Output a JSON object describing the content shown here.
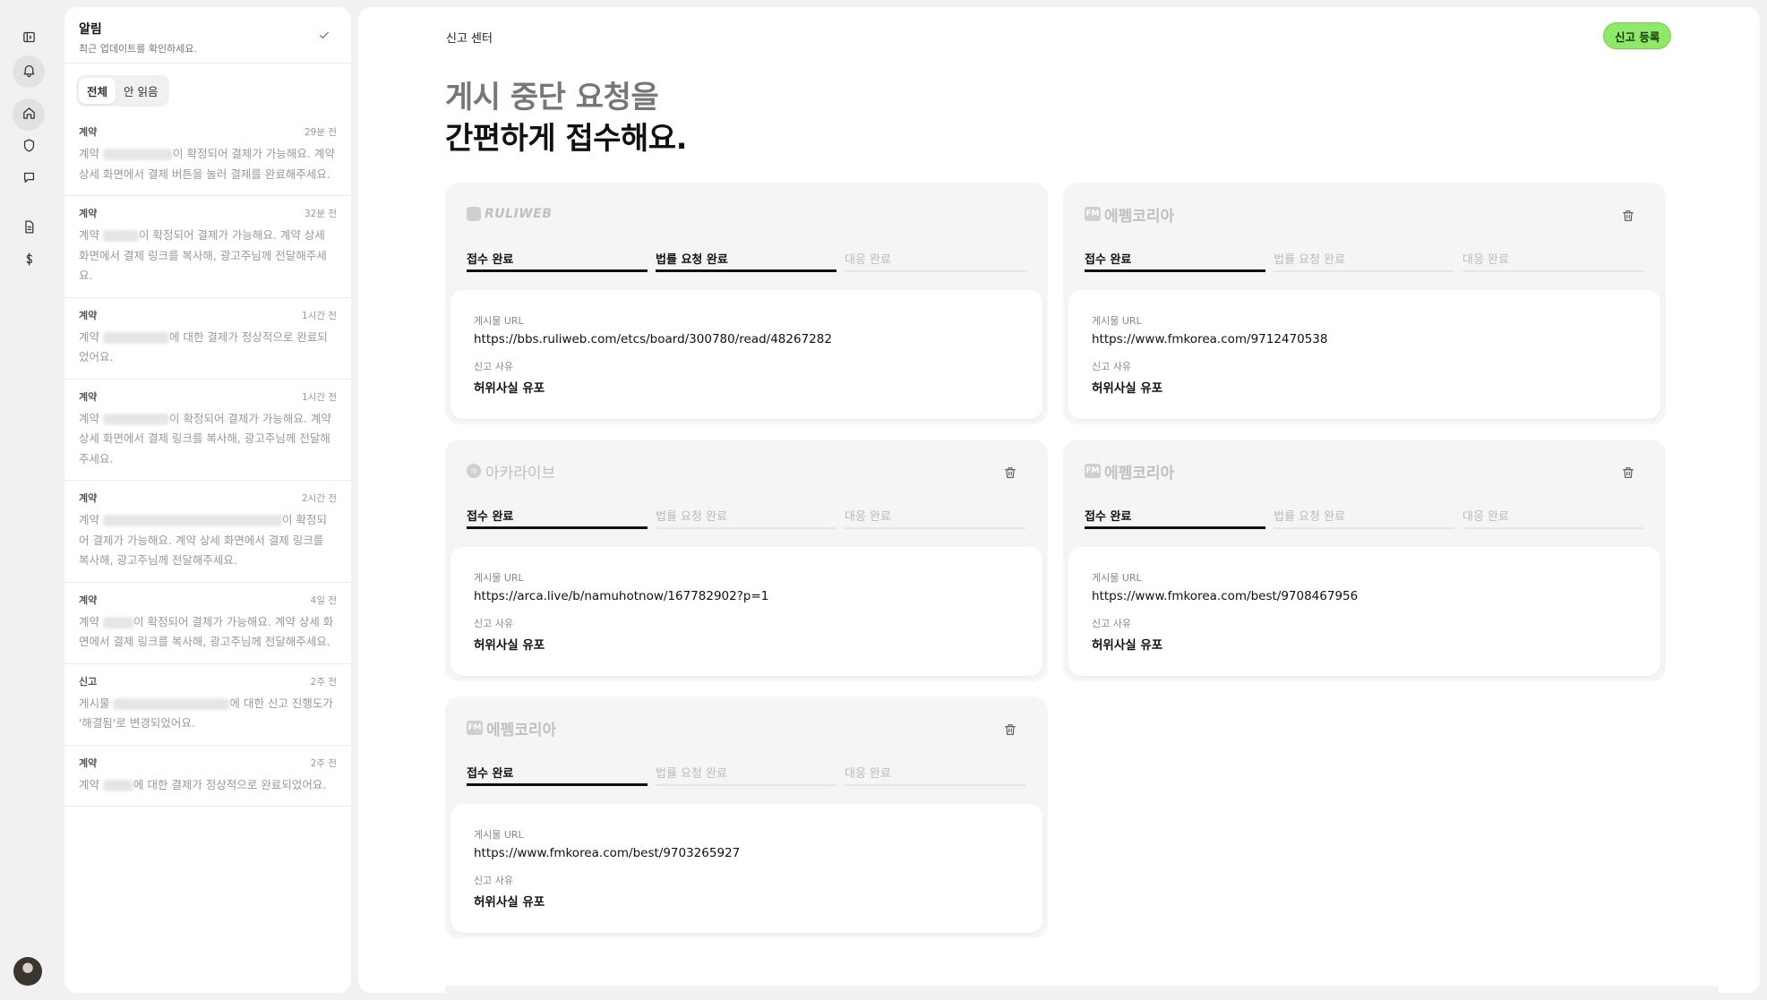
{
  "notifications": {
    "title": "알림",
    "subtitle": "최근 업데이트를 확인하세요.",
    "filters": [
      "전체",
      "안 읽음"
    ],
    "items": [
      {
        "type": "계약",
        "time": "29분 전",
        "pre": "계약 ",
        "post": "이 확정되어 결제가 가능해요. 계약 상세 화면에서 결제 버튼을 눌러 결제를 완료해주세요.",
        "blur_w": 78
      },
      {
        "type": "계약",
        "time": "32분 전",
        "pre": "계약 ",
        "post": "이 확정되어 결제가 가능해요. 계약 상세 화면에서 결제 링크를 복사해, 광고주님께 전달해주세요.",
        "blur_w": 40
      },
      {
        "type": "계약",
        "time": "1시간 전",
        "pre": "계약 ",
        "post": "에 대한 결제가 정상적으로 완료되었어요.",
        "blur_w": 74
      },
      {
        "type": "계약",
        "time": "1시간 전",
        "pre": "계약 ",
        "post": "이 확정되어 결제가 가능해요. 계약 상세 화면에서 결제 링크를 복사해, 광고주님께 전달해주세요.",
        "blur_w": 74
      },
      {
        "type": "계약",
        "time": "2시간 전",
        "pre": "계약 ",
        "post": "이 확정되어 결제가 가능해요. 계약 상세 화면에서 결제 링크를 복사해, 광고주님께 전달해주세요.",
        "blur_w": 200
      },
      {
        "type": "계약",
        "time": "4일 전",
        "pre": "계약 ",
        "post": "이 확정되어 결제가 가능해요. 계약 상세 화면에서 결제 링크를 복사해, 광고주님께 전달해주세요.",
        "blur_w": 34
      },
      {
        "type": "신고",
        "time": "2주 전",
        "pre": "게시물 ",
        "post": "에 대한 신고 진행도가 '해결됨'로 변경되었어요.",
        "blur_w": 130
      },
      {
        "type": "계약",
        "time": "2주 전",
        "pre": "계약 ",
        "post": "에 대한 결제가 정상적으로 완료되었어요.",
        "blur_w": 34
      }
    ]
  },
  "main": {
    "breadcrumb": "신고 센터",
    "cta_label": "신고 등록",
    "hero_line1": "게시 중단 요청을",
    "hero_line2": "간편하게 접수해요."
  },
  "steps": [
    "접수 완료",
    "법률 요청 완료",
    "대응 완료"
  ],
  "labels": {
    "url": "게시물 URL",
    "reason": "신고 사유"
  },
  "cards": [
    {
      "site": "RULIWEB",
      "logo_mark": "",
      "progress": 2,
      "url": "https://bbs.ruliweb.com/etcs/board/300780/read/48267282",
      "reason": "허위사실 유포",
      "deletable": false
    },
    {
      "site": "에펨코리아",
      "logo_mark": "FM",
      "progress": 1,
      "url": "https://www.fmkorea.com/9712470538",
      "reason": "허위사실 유포",
      "deletable": true
    },
    {
      "site": "아카라이브",
      "logo_mark": "아",
      "progress": 1,
      "url": "https://arca.live/b/namuhotnow/167782902?p=1",
      "reason": "허위사실 유포",
      "deletable": true
    },
    {
      "site": "에펨코리아",
      "logo_mark": "FM",
      "progress": 1,
      "url": "https://www.fmkorea.com/best/9708467956",
      "reason": "허위사실 유포",
      "deletable": true
    },
    {
      "site": "에펨코리아",
      "logo_mark": "FM",
      "progress": 1,
      "url": "https://www.fmkorea.com/best/9703265927",
      "reason": "허위사실 유포",
      "deletable": true
    }
  ],
  "colors": {
    "accent": "#8fe86a",
    "text": "#111111",
    "muted": "#999999"
  },
  "icons": [
    "sidebar-toggle-icon",
    "bell-icon",
    "home-icon",
    "shield-icon",
    "chat-icon",
    "document-icon",
    "dollar-icon",
    "check-icon",
    "trash-icon"
  ]
}
